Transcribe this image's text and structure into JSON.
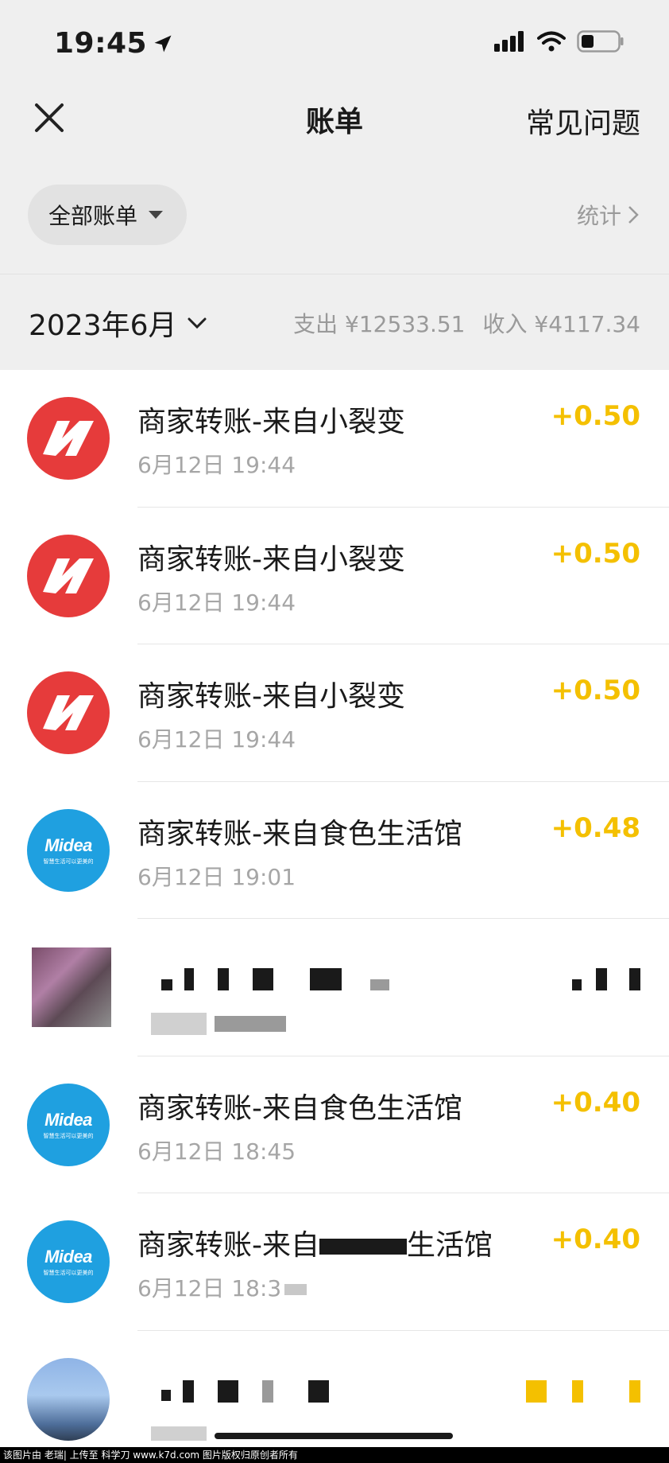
{
  "status": {
    "time": "19:45"
  },
  "nav": {
    "title": "账单",
    "faq": "常见问题"
  },
  "filter": {
    "label": "全部账单",
    "stats": "统计"
  },
  "month": {
    "label": "2023年6月",
    "expense": "支出 ¥12533.51",
    "income": "收入 ¥4117.34"
  },
  "transactions": [
    {
      "title": "商家转账-来自小裂变",
      "time": "6月12日 19:44",
      "amount": "+0.50",
      "icon": "bolt-logo"
    },
    {
      "title": "商家转账-来自小裂变",
      "time": "6月12日 19:44",
      "amount": "+0.50",
      "icon": "bolt-logo"
    },
    {
      "title": "商家转账-来自小裂变",
      "time": "6月12日 19:44",
      "amount": "+0.50",
      "icon": "bolt-logo"
    },
    {
      "title": "商家转账-来自食色生活馆",
      "time": "6月12日 19:01",
      "amount": "+0.48",
      "icon": "midea-logo"
    },
    {
      "title": "",
      "time": "",
      "amount": "",
      "icon": "blurred-avatar"
    },
    {
      "title": "商家转账-来自食色生活馆",
      "time": "6月12日 18:45",
      "amount": "+0.40",
      "icon": "midea-logo"
    },
    {
      "title_a": "商家转账-来自",
      "title_b": "生活馆",
      "time": "6月12日 18:3",
      "amount": "+0.40",
      "icon": "midea-logo"
    },
    {
      "title": "",
      "time": "",
      "amount": "",
      "icon": "blurred-avatar"
    }
  ],
  "brand": {
    "midea": "Midea",
    "midea_slogan": "智慧生活可以更美的"
  },
  "colors": {
    "income": "#f4c000",
    "header_bg": "#efefef",
    "bolt_red": "#e63b3b",
    "midea_blue": "#1fa0e0"
  },
  "footer": {
    "text": "该图片由 老瑞| 上传至 科学刀 www.k7d.com 图片版权归原创者所有"
  }
}
